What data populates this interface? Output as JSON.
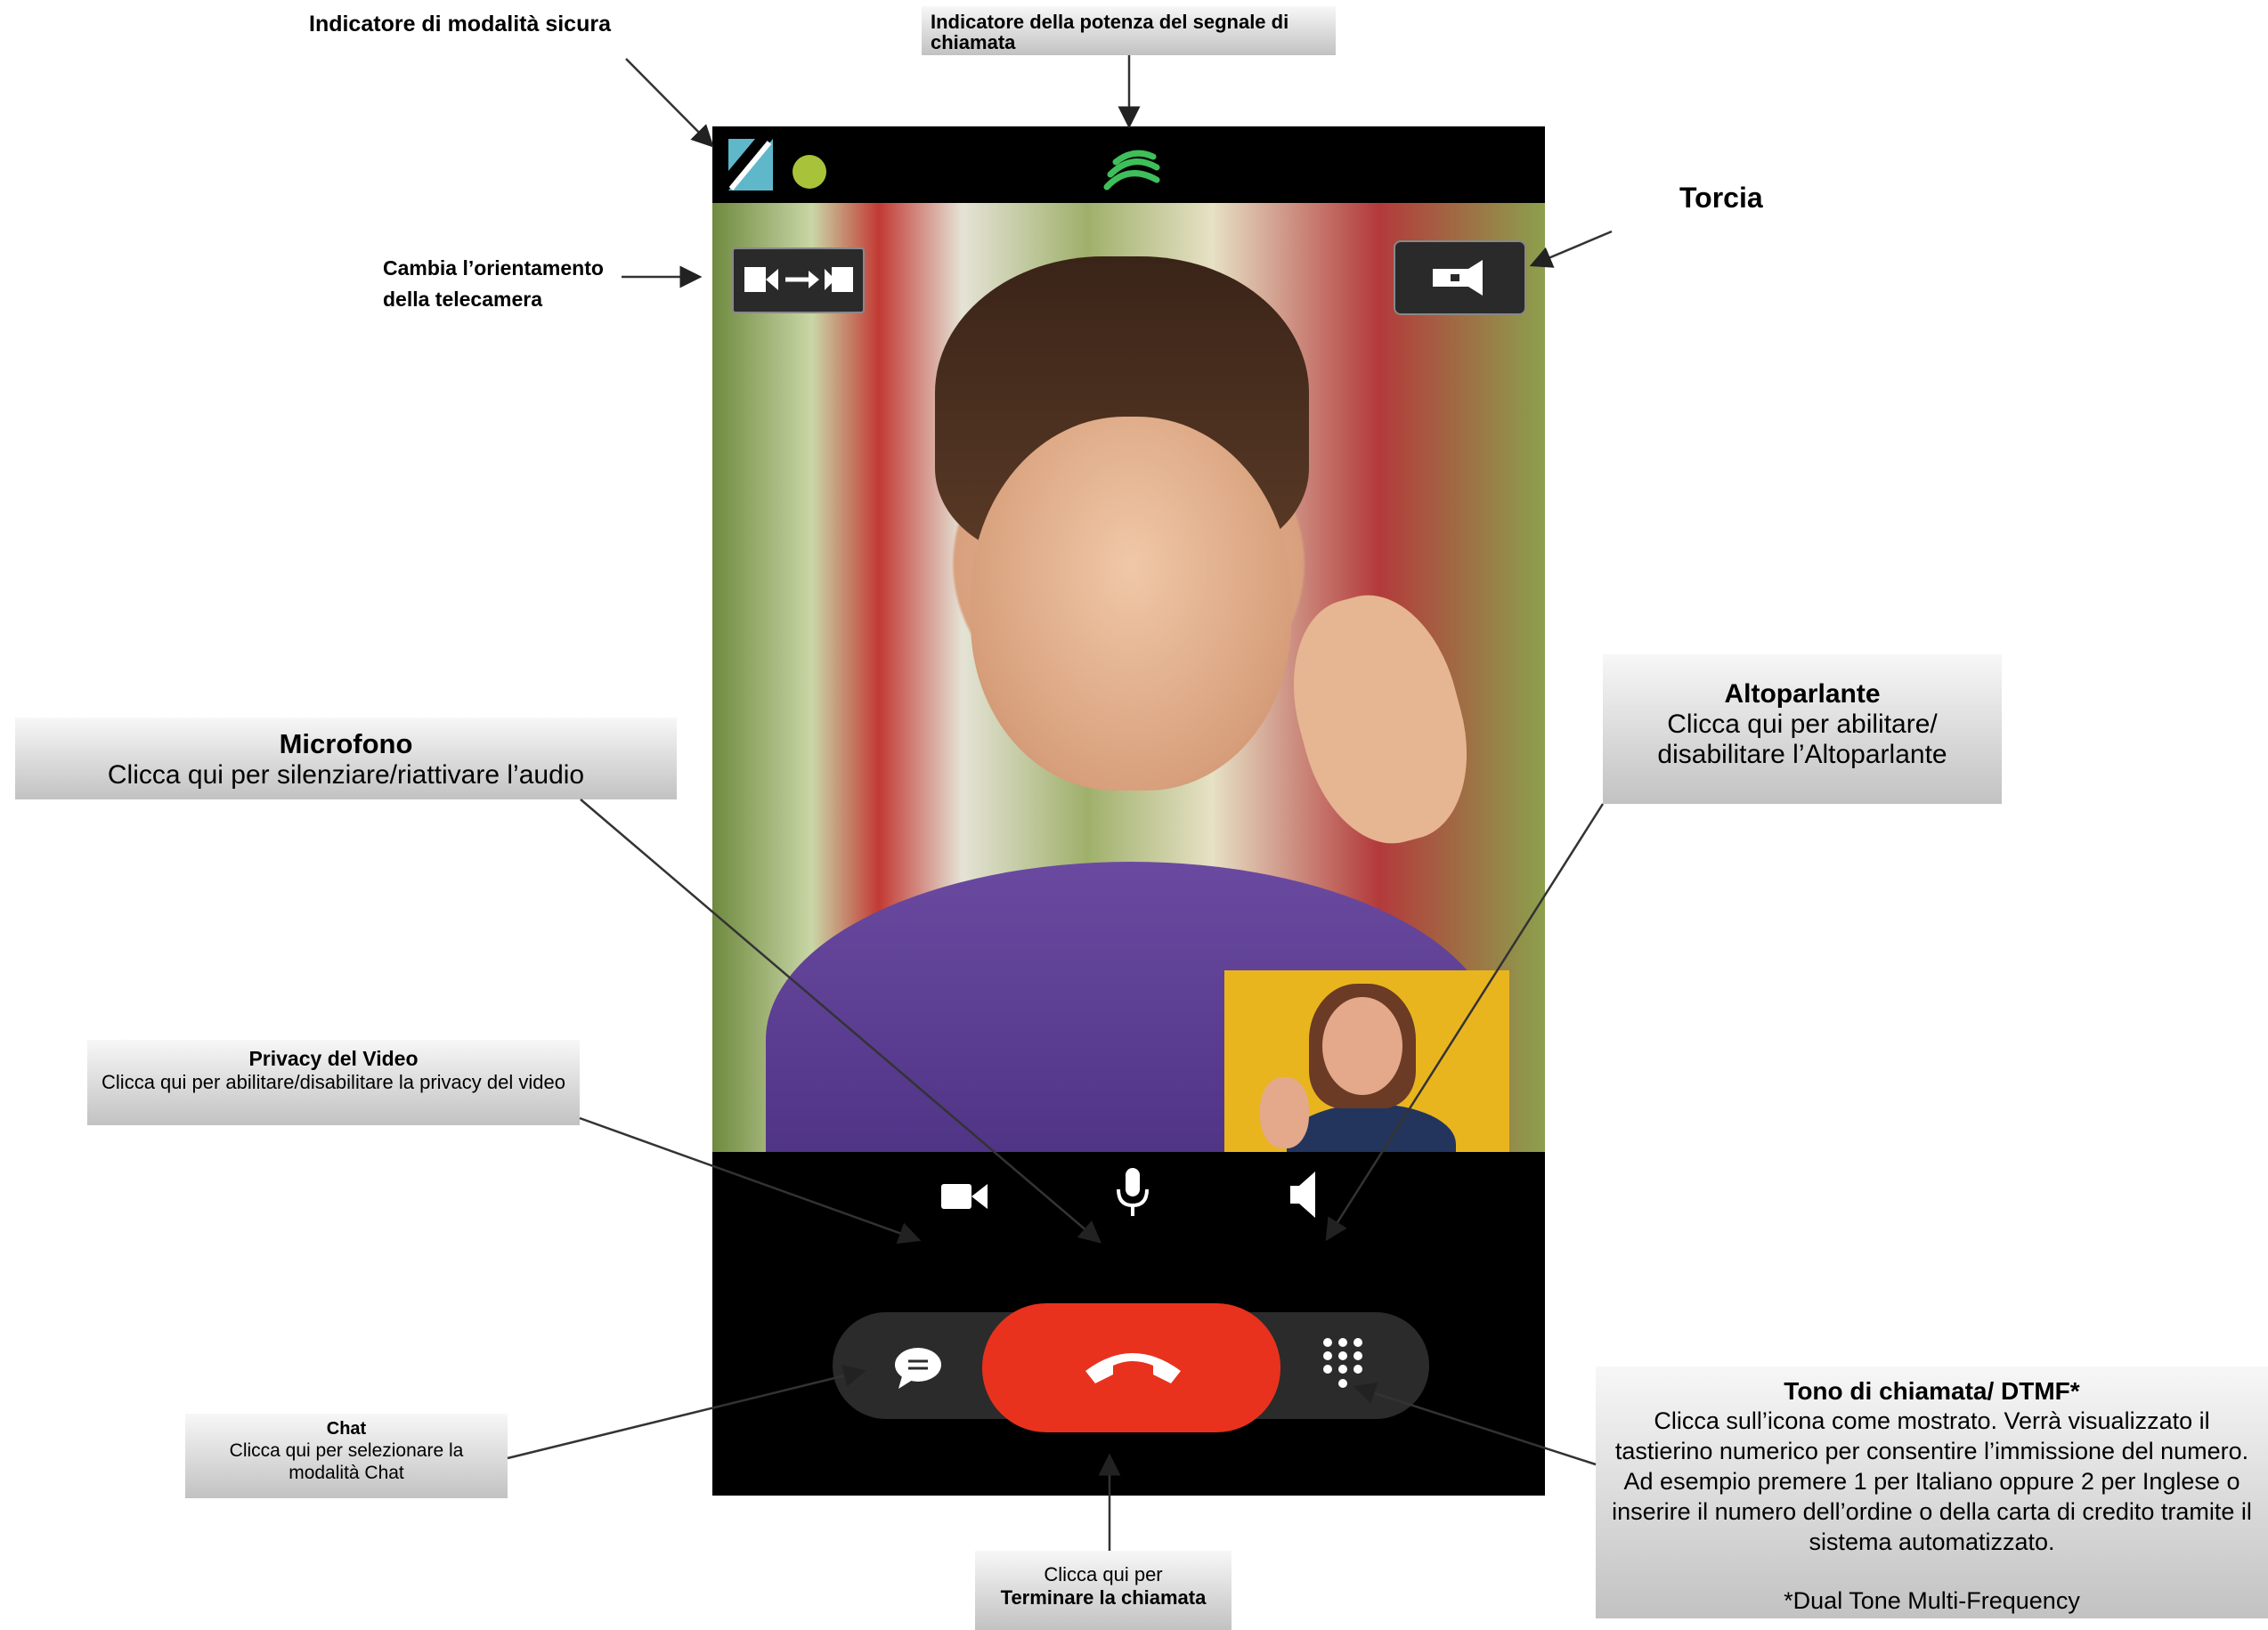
{
  "labels": {
    "secure_mode": "Indicatore di modalità sicura",
    "signal_strength": "Indicatore della potenza del segnale di chiamata",
    "torch": "Torcia",
    "camera_orientation_line1": "Cambia l’orientamento",
    "camera_orientation_line2": "della telecamera",
    "microphone_title": "Microfono",
    "microphone_desc": "Clicca qui per silenziare/riattivare l’audio",
    "speaker_title": "Altoparlante",
    "speaker_desc_line1": "Clicca qui per abilitare/",
    "speaker_desc_line2": "disabilitare l’Altoparlante",
    "video_privacy_title": "Privacy del Video",
    "video_privacy_desc": "Clicca qui per abilitare/disabilitare la privacy del video",
    "chat_title": "Chat",
    "chat_desc": "Clicca qui per selezionare la modalità Chat",
    "dtmf_title": "Tono di chiamata/ DTMF*",
    "dtmf_desc": "Clicca sull’icona come mostrato. Verrà visualizzato il tastierino numerico per consentire l’immissione del numero. Ad esempio premere 1 per Italiano oppure 2 per Inglese o inserire il numero dell’ordine o della carta di credito tramite il sistema automatizzato.",
    "dtmf_footnote": "*Dual Tone Multi-Frequency",
    "end_call_line1": "Clicca qui per",
    "end_call_line2": "Terminare la chiamata"
  },
  "icons": {
    "secure_mode": "secure-mode-icon",
    "status_dot": "status-dot-icon",
    "signal": "signal-strength-icon",
    "switch_camera": "switch-camera-icon",
    "torch": "torch-icon",
    "video": "video-camera-icon",
    "microphone": "microphone-icon",
    "speaker": "speaker-icon",
    "chat": "chat-bubble-icon",
    "end_call": "end-call-icon",
    "keypad": "keypad-icon"
  },
  "colors": {
    "end_call": "#e8321e",
    "signal": "#3fbf5a",
    "status_dot": "#a8c23a",
    "secure": "#5fb8c9"
  }
}
